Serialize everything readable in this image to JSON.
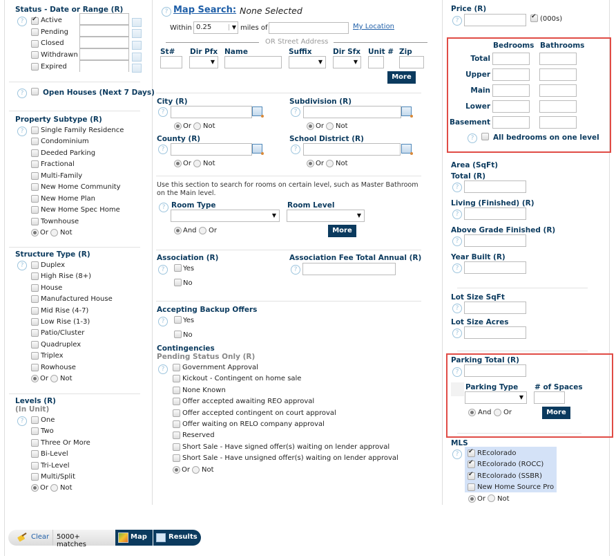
{
  "status": {
    "title": "Status - Date or Range (R)",
    "items": [
      {
        "label": "Active",
        "checked": true
      },
      {
        "label": "Pending",
        "checked": false
      },
      {
        "label": "Closed",
        "checked": false
      },
      {
        "label": "Withdrawn",
        "checked": false
      },
      {
        "label": "Expired",
        "checked": false
      }
    ]
  },
  "open_houses": {
    "label": "Open Houses (Next 7 Days)",
    "checked": false
  },
  "property_subtype": {
    "title": "Property Subtype (R)",
    "items": [
      "Single Family Residence",
      "Condominium",
      "Deeded Parking",
      "Fractional",
      "Multi-Family",
      "New Home Community",
      "New Home Plan",
      "New Home Spec Home",
      "Townhouse"
    ],
    "or_label": "Or",
    "not_label": "Not",
    "selected": "Or"
  },
  "structure_type": {
    "title": "Structure Type (R)",
    "items": [
      "Duplex",
      "High Rise (8+)",
      "House",
      "Manufactured House",
      "Mid Rise (4-7)",
      "Low Rise (1-3)",
      "Patio/Cluster",
      "Quadruplex",
      "Triplex",
      "Rowhouse"
    ],
    "or_label": "Or",
    "not_label": "Not",
    "selected": "Or"
  },
  "levels": {
    "title": "Levels (R)",
    "subtitle": "(In Unit)",
    "items": [
      "One",
      "Two",
      "Three Or More",
      "Bi-Level",
      "Tri-Level",
      "Multi/Split"
    ],
    "or_label": "Or",
    "not_label": "Not",
    "selected": "Or"
  },
  "map_search": {
    "link": "Map Search:",
    "value": "None Selected",
    "within_label": "Within",
    "within_value": "0.25",
    "miles_label": "miles of",
    "my_location": "My Location",
    "or_street": "OR Street Address",
    "columns": [
      "St#",
      "Dir Pfx",
      "Name",
      "Suffix",
      "Dir Sfx",
      "Unit #",
      "Zip"
    ],
    "more": "More"
  },
  "city": {
    "title": "City (R)",
    "or_label": "Or",
    "not_label": "Not"
  },
  "subdivision": {
    "title": "Subdivision (R)",
    "or_label": "Or",
    "not_label": "Not"
  },
  "county": {
    "title": "County (R)",
    "or_label": "Or",
    "not_label": "Not"
  },
  "school_district": {
    "title": "School District (R)",
    "or_label": "Or",
    "not_label": "Not"
  },
  "rooms": {
    "description": "Use this section to search for rooms on certain level, such as Master Bathroom on the Main level.",
    "room_type": "Room Type",
    "room_level": "Room Level",
    "and_label": "And",
    "or_label": "Or",
    "selected": "And",
    "more": "More"
  },
  "association": {
    "title": "Association (R)",
    "yes": "Yes",
    "no": "No"
  },
  "association_fee": {
    "title": "Association Fee Total Annual (R)"
  },
  "backup_offers": {
    "title": "Accepting Backup Offers",
    "yes": "Yes",
    "no": "No"
  },
  "contingencies": {
    "title": "Contingencies",
    "subtitle": "Pending Status Only (R)",
    "items": [
      "Government Approval",
      "Kickout - Contingent on home sale",
      "None Known",
      "Offer accepted awaiting REO approval",
      "Offer accepted contingent on court approval",
      "Offer waiting on RELO company approval",
      "Reserved",
      "Short Sale - Have signed offer(s) waiting on lender approval",
      "Short Sale - Have unsigned offer(s) waiting on lender approval"
    ],
    "or_label": "Or",
    "not_label": "Not",
    "selected": "Or"
  },
  "price": {
    "title": "Price (R)",
    "thousands_label": "(000s)",
    "thousands_checked": true
  },
  "beds_baths": {
    "col_bedrooms": "Bedrooms",
    "col_bathrooms": "Bathrooms",
    "rows": [
      "Total",
      "Upper",
      "Main",
      "Lower",
      "Basement"
    ],
    "all_one_level": "All bedrooms on one level"
  },
  "area": {
    "title": "Area (SqFt)",
    "fields": [
      "Total (R)",
      "Living (Finished) (R)",
      "Above Grade Finished (R)",
      "Year Built (R)"
    ]
  },
  "lot": {
    "fields": [
      "Lot Size SqFt",
      "Lot Size Acres"
    ]
  },
  "parking": {
    "title": "Parking Total (R)",
    "type_label": "Parking Type",
    "spaces_label": "# of Spaces",
    "and_label": "And",
    "or_label": "Or",
    "selected": "And",
    "more": "More"
  },
  "mls": {
    "title": "MLS",
    "items": [
      {
        "label": "REcolorado",
        "checked": true
      },
      {
        "label": "REcolorado (ROCC)",
        "checked": true
      },
      {
        "label": "REcolorado (SSBR)",
        "checked": true
      },
      {
        "label": "New Home Source Pro",
        "checked": false
      }
    ],
    "or_label": "Or",
    "not_label": "Not",
    "selected": "Or"
  },
  "bottom_bar": {
    "clear": "Clear",
    "matches": "5000+ matches",
    "map": "Map",
    "results": "Results"
  },
  "colors": {
    "accent": "#0b3a5e",
    "highlight_border": "#e04b45",
    "mls_bg": "#d4e2f7",
    "link": "#1f5fa8"
  }
}
